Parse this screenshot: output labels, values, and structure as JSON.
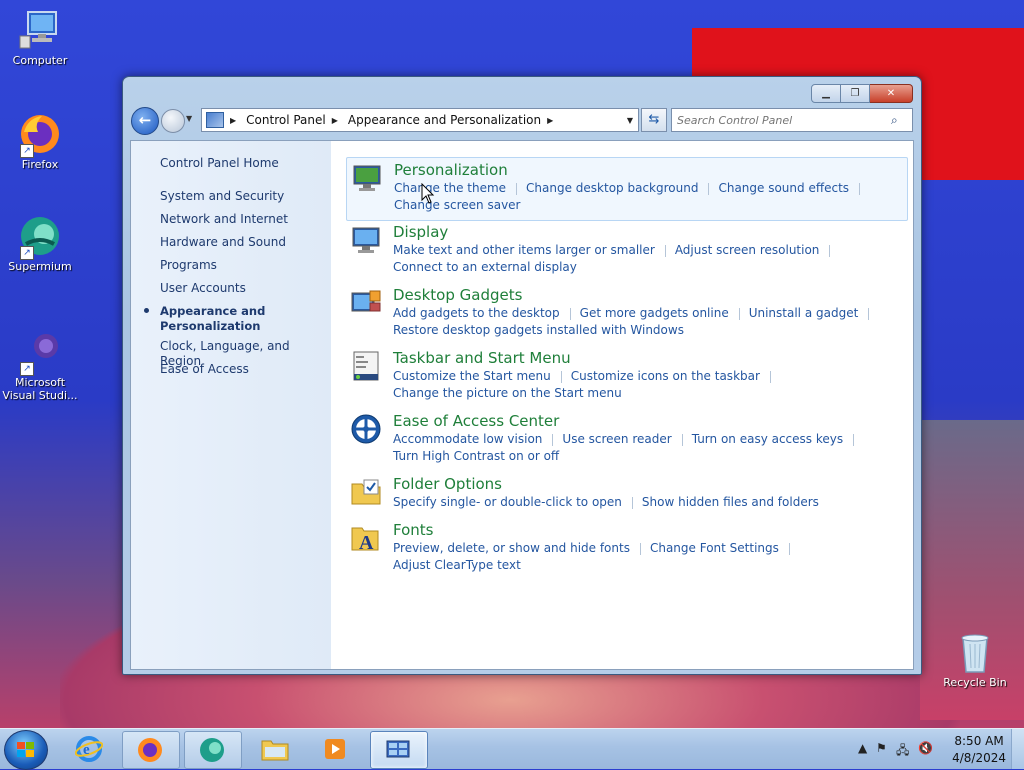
{
  "desktop": {
    "icons": [
      {
        "label": "Computer"
      },
      {
        "label": "Firefox"
      },
      {
        "label": "Supermium"
      },
      {
        "label": "Microsoft Visual Studi..."
      },
      {
        "label": "Recycle Bin"
      }
    ]
  },
  "window": {
    "controls": {
      "minimize": "▁",
      "maximize": "❐",
      "close": "✕"
    },
    "nav": {
      "back_icon": "back-arrow-icon",
      "forward_icon": "forward-arrow-icon"
    },
    "breadcrumb": [
      "Control Panel",
      "Appearance and Personalization"
    ],
    "search_placeholder": "Search Control Panel",
    "sidebar": {
      "home": "Control Panel Home",
      "items": [
        "System and Security",
        "Network and Internet",
        "Hardware and Sound",
        "Programs",
        "User Accounts",
        "Appearance and Personalization",
        "Clock, Language, and Region",
        "Ease of Access"
      ],
      "active_index": 5
    },
    "categories": [
      {
        "title": "Personalization",
        "icon": "monitor-theme-icon",
        "links": [
          "Change the theme",
          "Change desktop background",
          "Change sound effects",
          "Change screen saver"
        ]
      },
      {
        "title": "Display",
        "icon": "display-monitor-icon",
        "links": [
          "Make text and other items larger or smaller",
          "Adjust screen resolution",
          "Connect to an external display"
        ]
      },
      {
        "title": "Desktop Gadgets",
        "icon": "gadgets-icon",
        "links": [
          "Add gadgets to the desktop",
          "Get more gadgets online",
          "Uninstall a gadget",
          "Restore desktop gadgets installed with Windows"
        ]
      },
      {
        "title": "Taskbar and Start Menu",
        "icon": "taskbar-icon",
        "links": [
          "Customize the Start menu",
          "Customize icons on the taskbar",
          "Change the picture on the Start menu"
        ]
      },
      {
        "title": "Ease of Access Center",
        "icon": "ease-of-access-icon",
        "links": [
          "Accommodate low vision",
          "Use screen reader",
          "Turn on easy access keys",
          "Turn High Contrast on or off"
        ]
      },
      {
        "title": "Folder Options",
        "icon": "folder-options-icon",
        "links": [
          "Specify single- or double-click to open",
          "Show hidden files and folders"
        ]
      },
      {
        "title": "Fonts",
        "icon": "fonts-icon",
        "links": [
          "Preview, delete, or show and hide fonts",
          "Change Font Settings",
          "Adjust ClearType text"
        ]
      }
    ]
  },
  "taskbar": {
    "apps": [
      "start-orb-icon",
      "internet-explorer-icon",
      "firefox-icon",
      "supermium-icon",
      "file-explorer-icon",
      "media-player-icon",
      "control-panel-icon"
    ],
    "clock": {
      "time": "8:50 AM",
      "date": "4/8/2024"
    }
  },
  "colors": {
    "category_title": "#1f7f3a",
    "link": "#2456a0",
    "sidebar_text": "#1e3a6e"
  }
}
